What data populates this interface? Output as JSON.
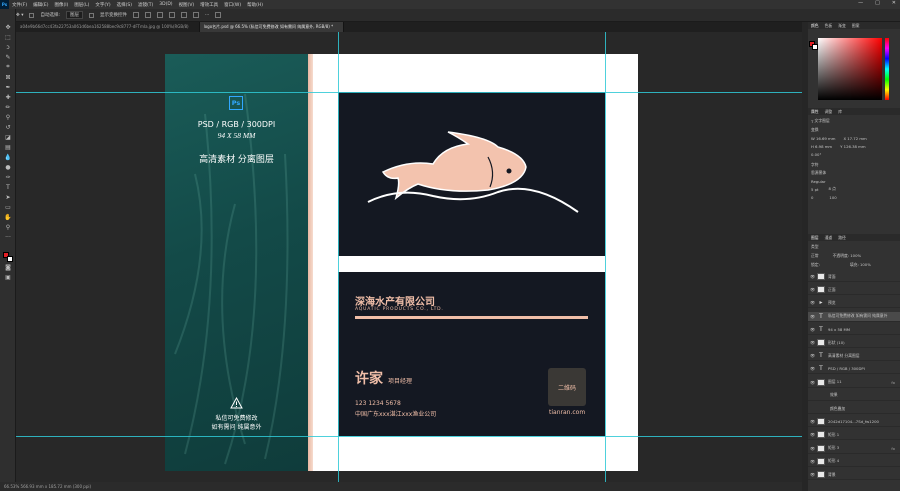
{
  "menu": [
    "文件(F)",
    "编辑(E)",
    "图像(I)",
    "图层(L)",
    "文字(Y)",
    "选择(S)",
    "滤镜(T)",
    "3D(D)",
    "视图(V)",
    "增效工具",
    "窗口(W)",
    "帮助(H)"
  ],
  "window_controls": [
    "—",
    "□",
    "✕"
  ],
  "options": {
    "auto_select": "自动选择:",
    "layer_dropdown": "图层",
    "show_transform": "显示变换控件"
  },
  "tabs": [
    {
      "label": "a04e9b66d7cc43fa22753a061d6bea162588bec9c8777-dFTmIa.jpg @ 100%(RGB/8)",
      "active": false
    },
    {
      "label": "logo名片.psd @ 66.5% (私信可免费修改 如有需问 纯属意外, RGB/8) *",
      "active": true
    }
  ],
  "left_card": {
    "ps_badge": "Ps",
    "specs": "PSD / RGB / 300DPI",
    "size": "94 X 58 MM",
    "title": "高清素材 分离图层",
    "notice1": "私信可免费修改",
    "notice2": "如有需问 纯属意外"
  },
  "business_card": {
    "company_cn": "深海水产有限公司",
    "company_en": "AQUATIC PRODUCTS CO., LTD.",
    "name": "许家",
    "role": "项目经理",
    "phone": "123 1234 5678",
    "address": "中国广东xxx湛江xxx渔业公司",
    "qr_label": "二维码",
    "website": "tianran.com"
  },
  "status": "66.53%    566.93 mm x 185.72 mm (300 ppi)",
  "panels": {
    "color_tabs": [
      "颜色",
      "色板",
      "渐变",
      "图案"
    ],
    "props_tabs": [
      "属性",
      "调整",
      "库"
    ],
    "props_layer_type": "文字图层",
    "transform_label": "变换",
    "W": "W  16.69 mm",
    "H": "H  6.98 mm",
    "X": "X  17.72 mm",
    "Y": "Y  126.38 mm",
    "angle": "0.00°",
    "char_label": "字符",
    "font": "思源黑体",
    "style": "Regular",
    "size": "5 pt",
    "leading": "8 点",
    "tracking": "0",
    "scale": "100",
    "layers_tabs": [
      "图层",
      "通道",
      "路径"
    ],
    "kind": "类型",
    "mode": "正常",
    "opacity": "不透明度: 100%",
    "lock": "锁定:",
    "fill": "填充: 100%",
    "layers": [
      {
        "name": "背面",
        "kind": "group",
        "fx": false,
        "selected": false
      },
      {
        "name": "正面",
        "kind": "group",
        "fx": false,
        "selected": false
      },
      {
        "name": "预览",
        "kind": "folder",
        "fx": false,
        "selected": false
      },
      {
        "name": "私信可免费修改 如有需问 纯属意外",
        "kind": "text",
        "fx": false,
        "selected": true
      },
      {
        "name": "94 x 58 MM",
        "kind": "text",
        "fx": false,
        "selected": false
      },
      {
        "name": "形状 (10)",
        "kind": "shape",
        "fx": false,
        "selected": false
      },
      {
        "name": "高清素材 分离图层",
        "kind": "text",
        "fx": false,
        "selected": false
      },
      {
        "name": "PSD / RGB / 300DPI",
        "kind": "text",
        "fx": false,
        "selected": false
      },
      {
        "name": "图层 11",
        "kind": "pixel",
        "fx": true,
        "selected": false
      },
      {
        "name": "效果",
        "kind": "sub",
        "fx": false,
        "selected": false
      },
      {
        "name": "颜色叠加",
        "kind": "sub",
        "fx": false,
        "selected": false
      },
      {
        "name": "2042d17104...7Sd_fw1200",
        "kind": "pixel",
        "fx": false,
        "selected": false
      },
      {
        "name": "矩形 1",
        "kind": "shape",
        "fx": false,
        "selected": false
      },
      {
        "name": "矩形 3",
        "kind": "shape",
        "fx": true,
        "selected": false
      },
      {
        "name": "矩形 4",
        "kind": "shape",
        "fx": false,
        "selected": false
      },
      {
        "name": "背景",
        "kind": "bg",
        "fx": false,
        "selected": false
      }
    ]
  },
  "colors": {
    "teal": "#134a48",
    "peach": "#f0bea8",
    "navy": "#141822",
    "guide": "#2fc9d6"
  }
}
